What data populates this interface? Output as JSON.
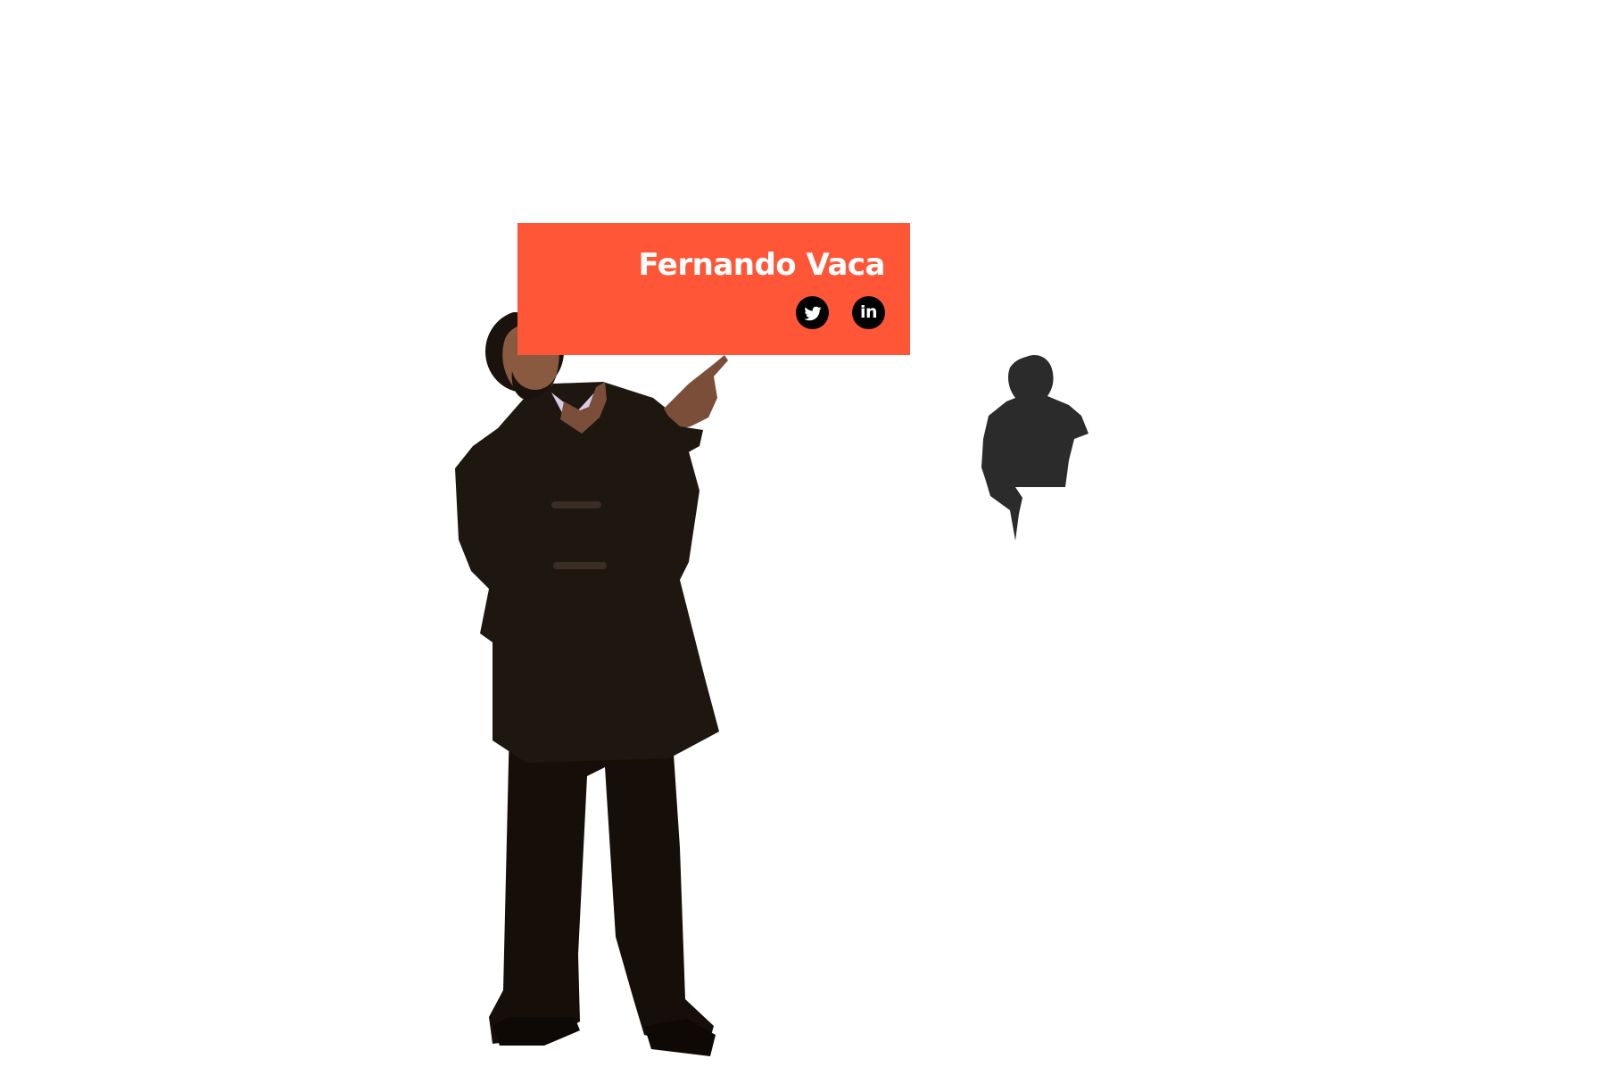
{
  "profile": {
    "name": "Fernando Vaca",
    "social": {
      "twitter_icon": "twitter-bird-icon",
      "linkedin_icon": "linkedin-icon",
      "linkedin_glyph": "in"
    }
  },
  "colors": {
    "background": "#ffffff",
    "card": "#FF5638",
    "icon_bg": "#000000",
    "icon_fg": "#ffffff",
    "silhouette": "#2b2b2b",
    "coat": "#1e1710",
    "skin": "#7a4e38",
    "shirt": "#d9cbe6"
  }
}
